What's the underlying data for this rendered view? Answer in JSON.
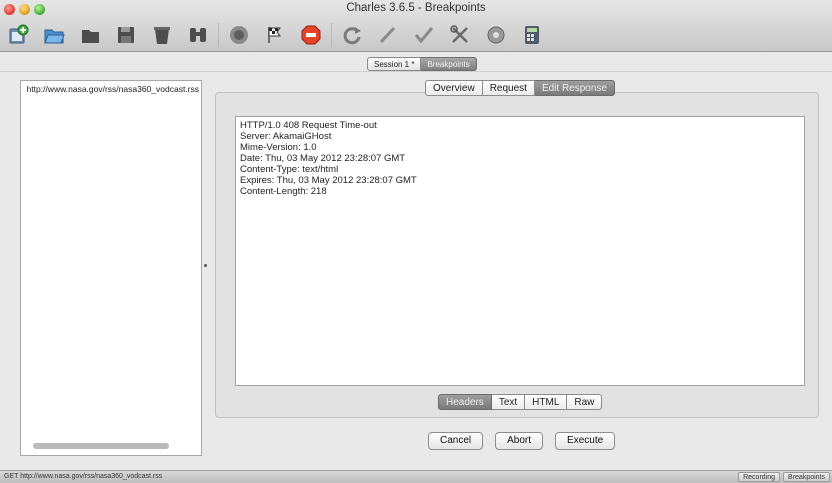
{
  "window": {
    "title": "Charles 3.6.5 - Breakpoints"
  },
  "toolbar": {
    "icons": [
      "new-session-icon",
      "open-session-icon",
      "close-session-icon",
      "save-session-icon",
      "clear-session-icon",
      "find-icon",
      "record-icon",
      "throttle-icon",
      "breakpoints-icon",
      "repeat-icon",
      "edit-icon",
      "validate-icon",
      "tools-icon",
      "settings-icon",
      "calculator-icon"
    ]
  },
  "session_tabs": [
    {
      "label": "Session 1 *",
      "active": false
    },
    {
      "label": "Breakpoints",
      "active": true
    }
  ],
  "request_list": {
    "items": [
      {
        "label": "http://www.nasa.gov/rss/nasa360_vodcast.rss"
      }
    ]
  },
  "view_tabs": [
    {
      "label": "Overview",
      "active": false
    },
    {
      "label": "Request",
      "active": false
    },
    {
      "label": "Edit Response",
      "active": true
    }
  ],
  "response_headers": [
    "HTTP/1.0 408 Request Time-out",
    "Server: AkamaiGHost",
    "Mime-Version: 1.0",
    "Date: Thu, 03 May 2012 23:28:07 GMT",
    "Content-Type: text/html",
    "Expires: Thu, 03 May 2012 23:28:07 GMT",
    "Content-Length: 218"
  ],
  "format_tabs": [
    {
      "label": "Headers",
      "active": true
    },
    {
      "label": "Text",
      "active": false
    },
    {
      "label": "HTML",
      "active": false
    },
    {
      "label": "Raw",
      "active": false
    }
  ],
  "actions": {
    "cancel": "Cancel",
    "abort": "Abort",
    "execute": "Execute"
  },
  "status_bar": {
    "text": "GET http://www.nasa.gov/rss/nasa360_vodcast.rss",
    "recording": "Recording",
    "breakpoints": "Breakpoints"
  },
  "colors": {
    "active_tab": "#8a8a8a",
    "breakpoint_arrow": "#d8231c"
  }
}
